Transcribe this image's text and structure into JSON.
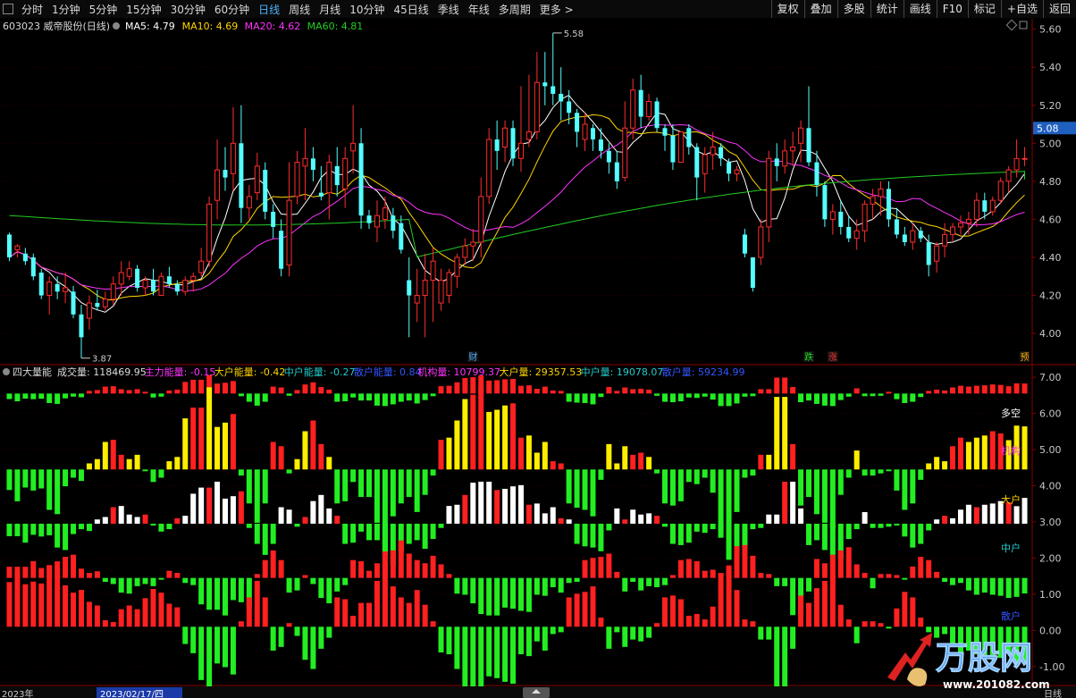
{
  "toolbar": {
    "periods": [
      "分时",
      "1分钟",
      "5分钟",
      "15分钟",
      "30分钟",
      "60分钟",
      "日线",
      "周线",
      "月线",
      "10分钟",
      "45日线",
      "季线",
      "年线",
      "多周期",
      "更多 >"
    ],
    "active_period": "日线",
    "right_buttons": [
      "复权",
      "叠加",
      "多股",
      "统计",
      "画线",
      "F10",
      "标记",
      "+自选",
      "返回"
    ]
  },
  "main_chart": {
    "stock_label": "603023 威帝股份(日线)",
    "ma": [
      {
        "label": "MA5: 4.79",
        "color": "#ffffff"
      },
      {
        "label": "MA10: 4.69",
        "color": "#ffd400"
      },
      {
        "label": "MA20: 4.62",
        "color": "#ff33ff"
      },
      {
        "label": "MA60: 4.81",
        "color": "#22cc22"
      }
    ],
    "price_axis": [
      "5.60",
      "5.40",
      "5.20",
      "5.08",
      "5.00",
      "4.80",
      "4.60",
      "4.40",
      "4.20",
      "4.00"
    ],
    "current_price": "5.08",
    "high_label": "5.58",
    "low_label": "3.87",
    "markers": [
      {
        "text": "财",
        "color": "#4fb3ff"
      },
      {
        "text": "跌",
        "color": "#22dd22"
      },
      {
        "text": "涨",
        "color": "#ff3333"
      },
      {
        "text": "预",
        "color": "#ffb300"
      }
    ]
  },
  "sub_chart": {
    "title": "四大量能",
    "items": [
      {
        "label": "成交量: 118469.95",
        "color": "#dddddd"
      },
      {
        "label": "主力能量: -0.15",
        "color": "#ff33ff"
      },
      {
        "label": "大户能量: -0.42",
        "color": "#ffd400"
      },
      {
        "label": "中户能量: -0.27",
        "color": "#22cccc"
      },
      {
        "label": "散户能量: 0.84",
        "color": "#3355ff"
      },
      {
        "label": "机构量: 10799.37",
        "color": "#ff33ff"
      },
      {
        "label": "大户量: 29357.53",
        "color": "#ffd400"
      },
      {
        "label": "中户量: 19078.07",
        "color": "#22cccc"
      },
      {
        "label": "散户量: 59234.99",
        "color": "#3355ff"
      }
    ],
    "axis": [
      "7.00",
      "6.00",
      "5.00",
      "4.00",
      "3.00",
      "2.00",
      "1.00",
      "0.00",
      "-1.00"
    ],
    "right_labels": [
      {
        "text": "多空",
        "color": "#ffffff"
      },
      {
        "text": "机构",
        "color": "#ff33ff"
      },
      {
        "text": "大户",
        "color": "#ffd400"
      },
      {
        "text": "中户",
        "color": "#22cccc"
      },
      {
        "text": "散户",
        "color": "#3355ff"
      }
    ]
  },
  "bottom_bar": {
    "date_left": "2023年",
    "date_selected": "2023/02/17/四",
    "period_right": "日线"
  },
  "watermark": {
    "text": "万股网",
    "url": "www.201082.com"
  },
  "chart_data": {
    "type": "candlestick",
    "ohlc": [
      [
        4.52,
        4.53,
        4.38,
        4.4
      ],
      [
        4.44,
        4.47,
        4.4,
        4.46
      ],
      [
        4.42,
        4.45,
        4.36,
        4.38
      ],
      [
        4.4,
        4.42,
        4.28,
        4.3
      ],
      [
        4.32,
        4.34,
        4.18,
        4.2
      ],
      [
        4.2,
        4.3,
        4.1,
        4.27
      ],
      [
        4.26,
        4.3,
        4.18,
        4.22
      ],
      [
        4.22,
        4.32,
        4.16,
        4.24
      ],
      [
        4.22,
        4.25,
        4.08,
        4.1
      ],
      [
        4.1,
        4.15,
        3.87,
        3.98
      ],
      [
        4.08,
        4.2,
        4.02,
        4.16
      ],
      [
        4.16,
        4.23,
        4.12,
        4.14
      ],
      [
        4.14,
        4.22,
        4.12,
        4.18
      ],
      [
        4.18,
        4.3,
        4.15,
        4.26
      ],
      [
        4.26,
        4.38,
        4.2,
        4.32
      ],
      [
        4.3,
        4.38,
        4.28,
        4.34
      ],
      [
        4.34,
        4.36,
        4.22,
        4.24
      ],
      [
        4.24,
        4.3,
        4.2,
        4.28
      ],
      [
        4.28,
        4.34,
        4.2,
        4.22
      ],
      [
        4.2,
        4.32,
        4.2,
        4.3
      ],
      [
        4.3,
        4.35,
        4.24,
        4.26
      ],
      [
        4.26,
        4.28,
        4.2,
        4.22
      ],
      [
        4.22,
        4.3,
        4.2,
        4.28
      ],
      [
        4.28,
        4.32,
        4.22,
        4.3
      ],
      [
        4.32,
        4.45,
        4.3,
        4.38
      ],
      [
        4.38,
        4.72,
        4.35,
        4.68
      ],
      [
        4.7,
        5.02,
        4.6,
        4.86
      ],
      [
        4.86,
        4.98,
        4.75,
        4.82
      ],
      [
        4.84,
        5.19,
        4.75,
        5.0
      ],
      [
        5.0,
        5.2,
        4.58,
        4.66
      ],
      [
        4.66,
        4.78,
        4.6,
        4.72
      ],
      [
        4.74,
        4.95,
        4.7,
        4.88
      ],
      [
        4.86,
        4.9,
        4.6,
        4.64
      ],
      [
        4.64,
        4.68,
        4.5,
        4.56
      ],
      [
        4.54,
        4.6,
        4.3,
        4.34
      ],
      [
        4.36,
        4.9,
        4.3,
        4.7
      ],
      [
        4.72,
        4.96,
        4.68,
        4.9
      ],
      [
        4.88,
        5.08,
        4.7,
        4.92
      ],
      [
        4.92,
        4.98,
        4.8,
        4.86
      ],
      [
        4.74,
        4.88,
        4.7,
        4.72
      ],
      [
        4.74,
        4.94,
        4.6,
        4.9
      ],
      [
        4.88,
        4.98,
        4.72,
        4.78
      ],
      [
        4.76,
        4.98,
        4.66,
        4.92
      ],
      [
        4.96,
        5.2,
        4.84,
        5.0
      ],
      [
        5.0,
        5.08,
        4.55,
        4.62
      ],
      [
        4.62,
        4.65,
        4.55,
        4.58
      ],
      [
        4.56,
        4.7,
        4.48,
        4.62
      ],
      [
        4.6,
        4.72,
        4.55,
        4.66
      ],
      [
        4.62,
        4.66,
        4.5,
        4.54
      ],
      [
        4.58,
        4.62,
        4.42,
        4.44
      ],
      [
        4.28,
        4.4,
        3.98,
        4.2
      ],
      [
        4.16,
        4.34,
        4.06,
        4.2
      ],
      [
        4.2,
        4.42,
        3.98,
        4.28
      ],
      [
        4.28,
        4.45,
        4.06,
        4.38
      ],
      [
        4.16,
        4.34,
        4.12,
        4.28
      ],
      [
        4.2,
        4.34,
        4.16,
        4.32
      ],
      [
        4.3,
        4.42,
        4.24,
        4.4
      ],
      [
        4.4,
        4.5,
        4.36,
        4.46
      ],
      [
        4.46,
        4.55,
        4.38,
        4.48
      ],
      [
        4.48,
        4.82,
        4.4,
        4.72
      ],
      [
        4.72,
        5.08,
        4.68,
        5.02
      ],
      [
        5.02,
        5.12,
        4.86,
        4.96
      ],
      [
        4.98,
        5.12,
        4.9,
        5.08
      ],
      [
        5.08,
        5.12,
        4.88,
        4.92
      ],
      [
        4.92,
        5.3,
        4.85,
        5.0
      ],
      [
        5.02,
        5.36,
        4.98,
        5.06
      ],
      [
        5.06,
        5.48,
        5.02,
        5.32
      ],
      [
        5.32,
        5.48,
        5.2,
        5.3
      ],
      [
        5.3,
        5.58,
        5.2,
        5.26
      ],
      [
        5.26,
        5.4,
        5.12,
        5.22
      ],
      [
        5.22,
        5.28,
        5.1,
        5.16
      ],
      [
        5.16,
        5.18,
        4.98,
        5.06
      ],
      [
        5.02,
        5.16,
        4.96,
        5.1
      ],
      [
        5.08,
        5.1,
        4.96,
        5.02
      ],
      [
        5.02,
        5.08,
        4.92,
        4.96
      ],
      [
        4.96,
        5.0,
        4.84,
        4.9
      ],
      [
        4.9,
        4.96,
        4.76,
        4.8
      ],
      [
        4.82,
        5.22,
        4.8,
        5.08
      ],
      [
        5.08,
        5.34,
        5.02,
        5.28
      ],
      [
        5.28,
        5.36,
        5.08,
        5.14
      ],
      [
        5.14,
        5.26,
        5.12,
        5.22
      ],
      [
        5.22,
        5.24,
        5.06,
        5.08
      ],
      [
        5.08,
        5.1,
        4.96,
        5.04
      ],
      [
        5.04,
        5.1,
        4.86,
        4.9
      ],
      [
        4.9,
        5.04,
        4.9,
        5.06
      ],
      [
        5.08,
        5.1,
        4.94,
        4.98
      ],
      [
        4.98,
        5.0,
        4.7,
        4.82
      ],
      [
        4.84,
        4.98,
        4.74,
        4.94
      ],
      [
        4.94,
        5.06,
        4.86,
        4.98
      ],
      [
        4.98,
        5.0,
        4.88,
        4.92
      ],
      [
        4.9,
        4.92,
        4.8,
        4.84
      ],
      [
        4.84,
        4.88,
        4.8,
        4.86
      ],
      [
        4.52,
        4.55,
        4.4,
        4.42
      ],
      [
        4.4,
        4.4,
        4.22,
        4.24
      ],
      [
        4.4,
        4.6,
        4.36,
        4.56
      ],
      [
        4.56,
        4.96,
        4.48,
        4.92
      ],
      [
        4.92,
        5.0,
        4.8,
        4.88
      ],
      [
        4.88,
        5.02,
        4.84,
        4.96
      ],
      [
        4.96,
        5.06,
        4.88,
        4.98
      ],
      [
        5.0,
        5.12,
        4.9,
        5.08
      ],
      [
        5.08,
        5.3,
        4.88,
        4.9
      ],
      [
        4.9,
        4.96,
        4.72,
        4.78
      ],
      [
        4.78,
        4.8,
        4.56,
        4.6
      ],
      [
        4.6,
        4.68,
        4.52,
        4.64
      ],
      [
        4.64,
        4.7,
        4.52,
        4.56
      ],
      [
        4.56,
        4.62,
        4.48,
        4.5
      ],
      [
        4.5,
        4.6,
        4.44,
        4.54
      ],
      [
        4.54,
        4.7,
        4.48,
        4.68
      ],
      [
        4.68,
        4.76,
        4.6,
        4.72
      ],
      [
        4.72,
        4.8,
        4.62,
        4.76
      ],
      [
        4.76,
        4.8,
        4.56,
        4.6
      ],
      [
        4.6,
        4.66,
        4.5,
        4.52
      ],
      [
        4.52,
        4.56,
        4.46,
        4.48
      ],
      [
        4.48,
        4.58,
        4.44,
        4.54
      ],
      [
        4.54,
        4.56,
        4.48,
        4.5
      ],
      [
        4.48,
        4.52,
        4.3,
        4.36
      ],
      [
        4.38,
        4.48,
        4.32,
        4.46
      ],
      [
        4.46,
        4.58,
        4.4,
        4.52
      ],
      [
        4.52,
        4.58,
        4.48,
        4.56
      ],
      [
        4.56,
        4.62,
        4.52,
        4.58
      ],
      [
        4.58,
        4.64,
        4.52,
        4.6
      ],
      [
        4.6,
        4.74,
        4.56,
        4.7
      ],
      [
        4.7,
        4.74,
        4.6,
        4.64
      ],
      [
        4.64,
        4.72,
        4.62,
        4.7
      ],
      [
        4.7,
        4.82,
        4.68,
        4.8
      ],
      [
        4.8,
        4.88,
        4.74,
        4.86
      ],
      [
        4.86,
        5.02,
        4.82,
        4.92
      ],
      [
        4.92,
        4.98,
        4.88,
        4.92
      ]
    ],
    "ma60_endpoints": [
      4.62,
      4.81
    ],
    "ylim": [
      3.85,
      5.65
    ]
  },
  "volume_panel": {
    "ylim": [
      -1.5,
      7.3
    ]
  }
}
